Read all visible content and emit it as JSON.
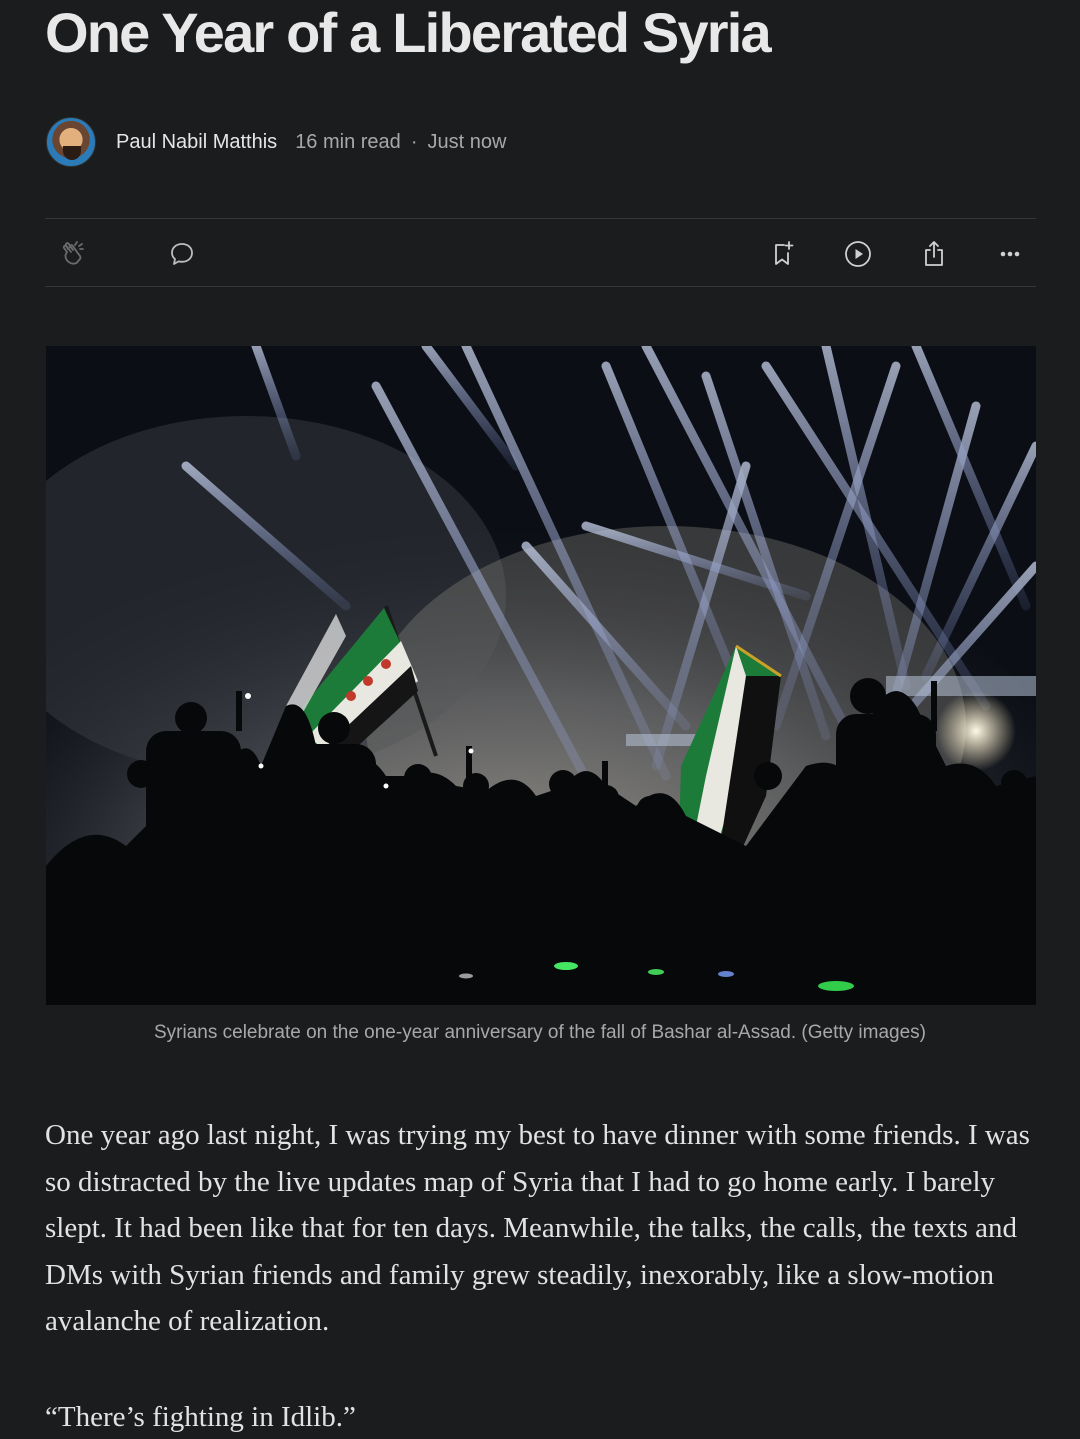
{
  "article": {
    "title": "One Year of a Liberated Syria",
    "author": "Paul Nabil Matthis",
    "read_time": "16 min read",
    "separator": "·",
    "published": "Just now"
  },
  "actions": {
    "icons": [
      "clap-icon",
      "comment-icon",
      "bookmark-add-icon",
      "play-icon",
      "share-icon",
      "more-icon"
    ]
  },
  "image": {
    "caption": "Syrians celebrate on the one-year anniversary of the fall of Bashar al-Assad. (Getty images)"
  },
  "content": {
    "paragraph_1": "One year ago last night, I was trying my best to have dinner with some friends. I was so distracted by the live updates map of Syria that I had to go home early. I barely slept. It had been like that for ten days. Meanwhile, the talks, the calls, the texts and DMs with Syrian friends and family grew steadily, inexorably, like a slow-motion avalanche of realization.",
    "quote_1": "“There’s fighting in Idlib.”"
  },
  "colors": {
    "background": "#1b1c1e",
    "text": "#e6e6e6",
    "muted": "#a8a8a8",
    "divider": "#34363a"
  }
}
